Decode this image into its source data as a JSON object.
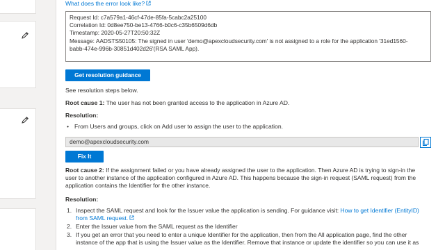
{
  "header": {
    "link_text": "What does the error look like?",
    "link_icon": "external-link-icon"
  },
  "error_box": {
    "lines": [
      "Request Id: c7a579a1-46cf-47de-85fa-5cabc2a25100",
      "Correlation Id: 0d8ee750-be13-4766-b0c6-c35b6509d6db",
      "Timestamp: 2020-05-27T20:50:32Z",
      "Message: AADSTS50105: The signed in user 'demo@apexcloudsecurity.com' is not assigned to a role for the application '31ed1560-",
      "babb-474e-996b-30851d402d26'(RSA SAML App)."
    ]
  },
  "buttons": {
    "resolution_guidance": "Get resolution guidance",
    "fix_it": "Fix It"
  },
  "steps_intro": "See resolution steps below.",
  "root_cause_1": {
    "label": "Root cause 1:",
    "text": " The user has not been granted access to the application in Azure AD."
  },
  "resolution_1": {
    "label": "Resolution:",
    "bullet": "From Users and groups, click on Add user to assign the user to the application."
  },
  "copy_field": {
    "value": "demo@apexcloudsecurity.com",
    "icon": "copy-icon"
  },
  "root_cause_2": {
    "label": "Root cause 2:",
    "lines": [
      " If the assignment failed or you have already assigned the user to the application. Then Azure AD is trying to sign-in the",
      "user to another instance of the application configured in Azure AD. This happens because the sign-in request (SAML request) from the",
      "application contains the Identifier for the other instance."
    ]
  },
  "resolution_2": {
    "label": "Resolution:",
    "items": [
      {
        "n": "1.",
        "line1": "Inspect the SAML request and look for the Issuer value the application is sending. For guidance visit: ",
        "link1": "How to get Identifier (EntityID)",
        "link2": "from SAML request."
      },
      {
        "n": "2.",
        "text": "Enter the Issuer value from the SAML request as the Identifier"
      },
      {
        "n": "3.",
        "lines": [
          "If you get an error that you need to enter a unique Identifier for the application, then from the All application page, find the other",
          "instance of the app that is using the Issuer value as the Identifier. Remove that instance or update the identifier so you can use it as"
        ]
      }
    ]
  },
  "colors": {
    "accent": "#0078d4",
    "text": "#323130",
    "field_bg": "#e8e8e8"
  }
}
